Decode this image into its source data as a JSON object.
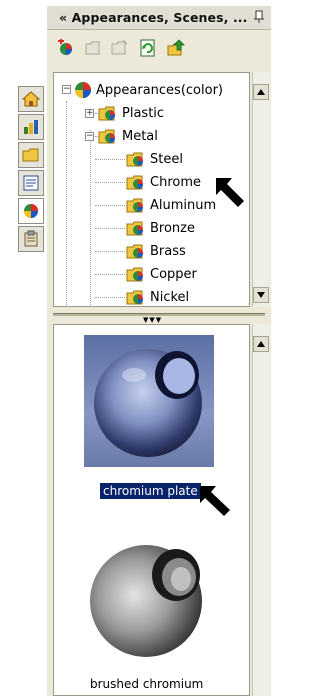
{
  "panel": {
    "title": "« Appearances, Scenes, ..."
  },
  "toolbar": {
    "buttons": [
      "add-appearance-icon",
      "open-folder-icon",
      "new-folder-icon",
      "refresh-icon",
      "move-up-icon"
    ]
  },
  "left_tabs": [
    "home-icon",
    "chart-icon",
    "folder-icon",
    "properties-icon",
    "appearances-icon",
    "clipboard-icon"
  ],
  "tree": {
    "root": "Appearances(color)",
    "plastic": "Plastic",
    "metal": "Metal",
    "metals": [
      "Steel",
      "Chrome",
      "Aluminum",
      "Bronze",
      "Brass",
      "Copper",
      "Nickel"
    ]
  },
  "preview": {
    "items": [
      {
        "caption": "chromium plate",
        "selected": true
      },
      {
        "caption": "brushed chromium",
        "selected": false
      }
    ]
  },
  "colors": {
    "panel_bg": "#ece9d8",
    "selection": "#0a246a"
  }
}
